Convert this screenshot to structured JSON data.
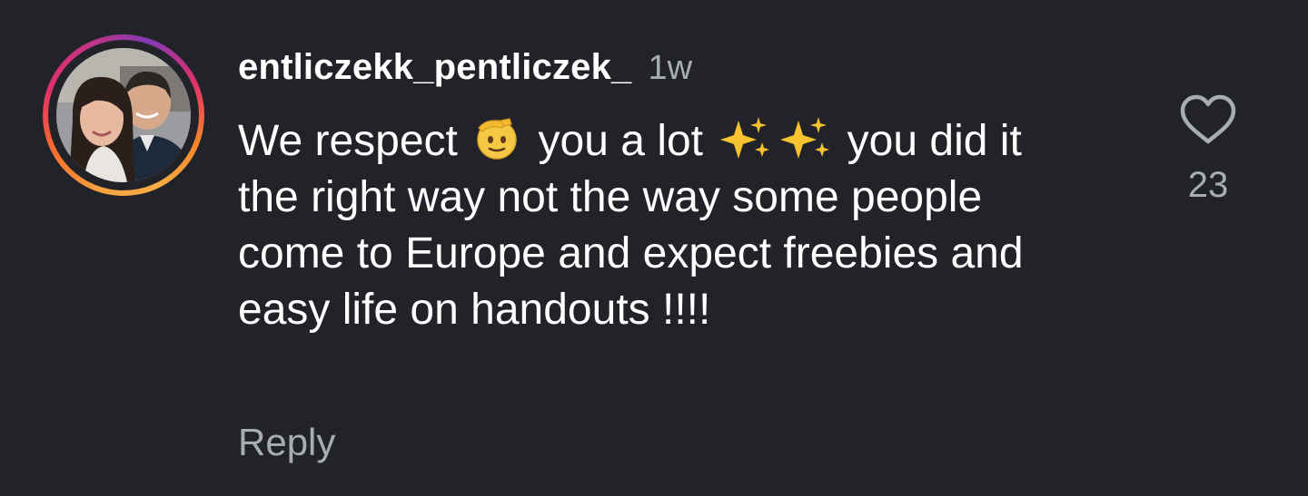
{
  "comment": {
    "username": "entliczekk_pentliczek_",
    "timestamp": "1w",
    "text_parts": {
      "p1": "We respect ",
      "p2": " you a lot ",
      "p3": " you did it the right way not the way some people come to Europe and expect freebies and easy life on handouts !!!!"
    },
    "emoji": {
      "salute": "saluting-face",
      "sparkles": "sparkles"
    },
    "reply_label": "Reply",
    "like_count": "23"
  },
  "colors": {
    "background": "#222328",
    "text_primary": "#ffffff",
    "text_secondary": "#a8acb3",
    "story_ring_start": "#f58529",
    "story_ring_end": "#c13584"
  }
}
